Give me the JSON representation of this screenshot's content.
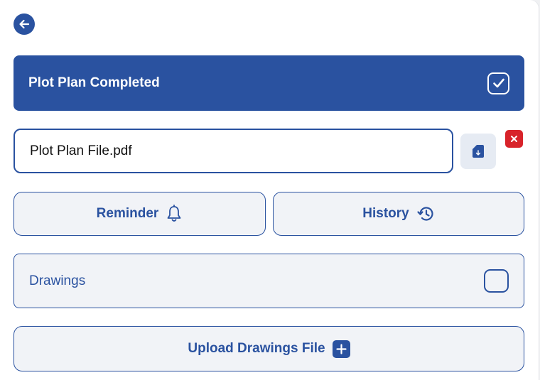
{
  "navigation": {
    "back_icon": "arrow-left-icon"
  },
  "status_banner": {
    "title": "Plot Plan Completed",
    "checked": true,
    "icon": "check-icon",
    "color": "#2a52a0"
  },
  "file": {
    "name": "Plot Plan File.pdf",
    "download_icon": "file-download-icon",
    "delete_icon": "close-icon",
    "delete_color": "#d8232a"
  },
  "actions": {
    "reminder_label": "Reminder",
    "reminder_icon": "bell-icon",
    "history_label": "History",
    "history_icon": "history-icon"
  },
  "drawings": {
    "label": "Drawings",
    "checked": false
  },
  "upload": {
    "label": "Upload Drawings File",
    "icon": "plus-icon"
  }
}
